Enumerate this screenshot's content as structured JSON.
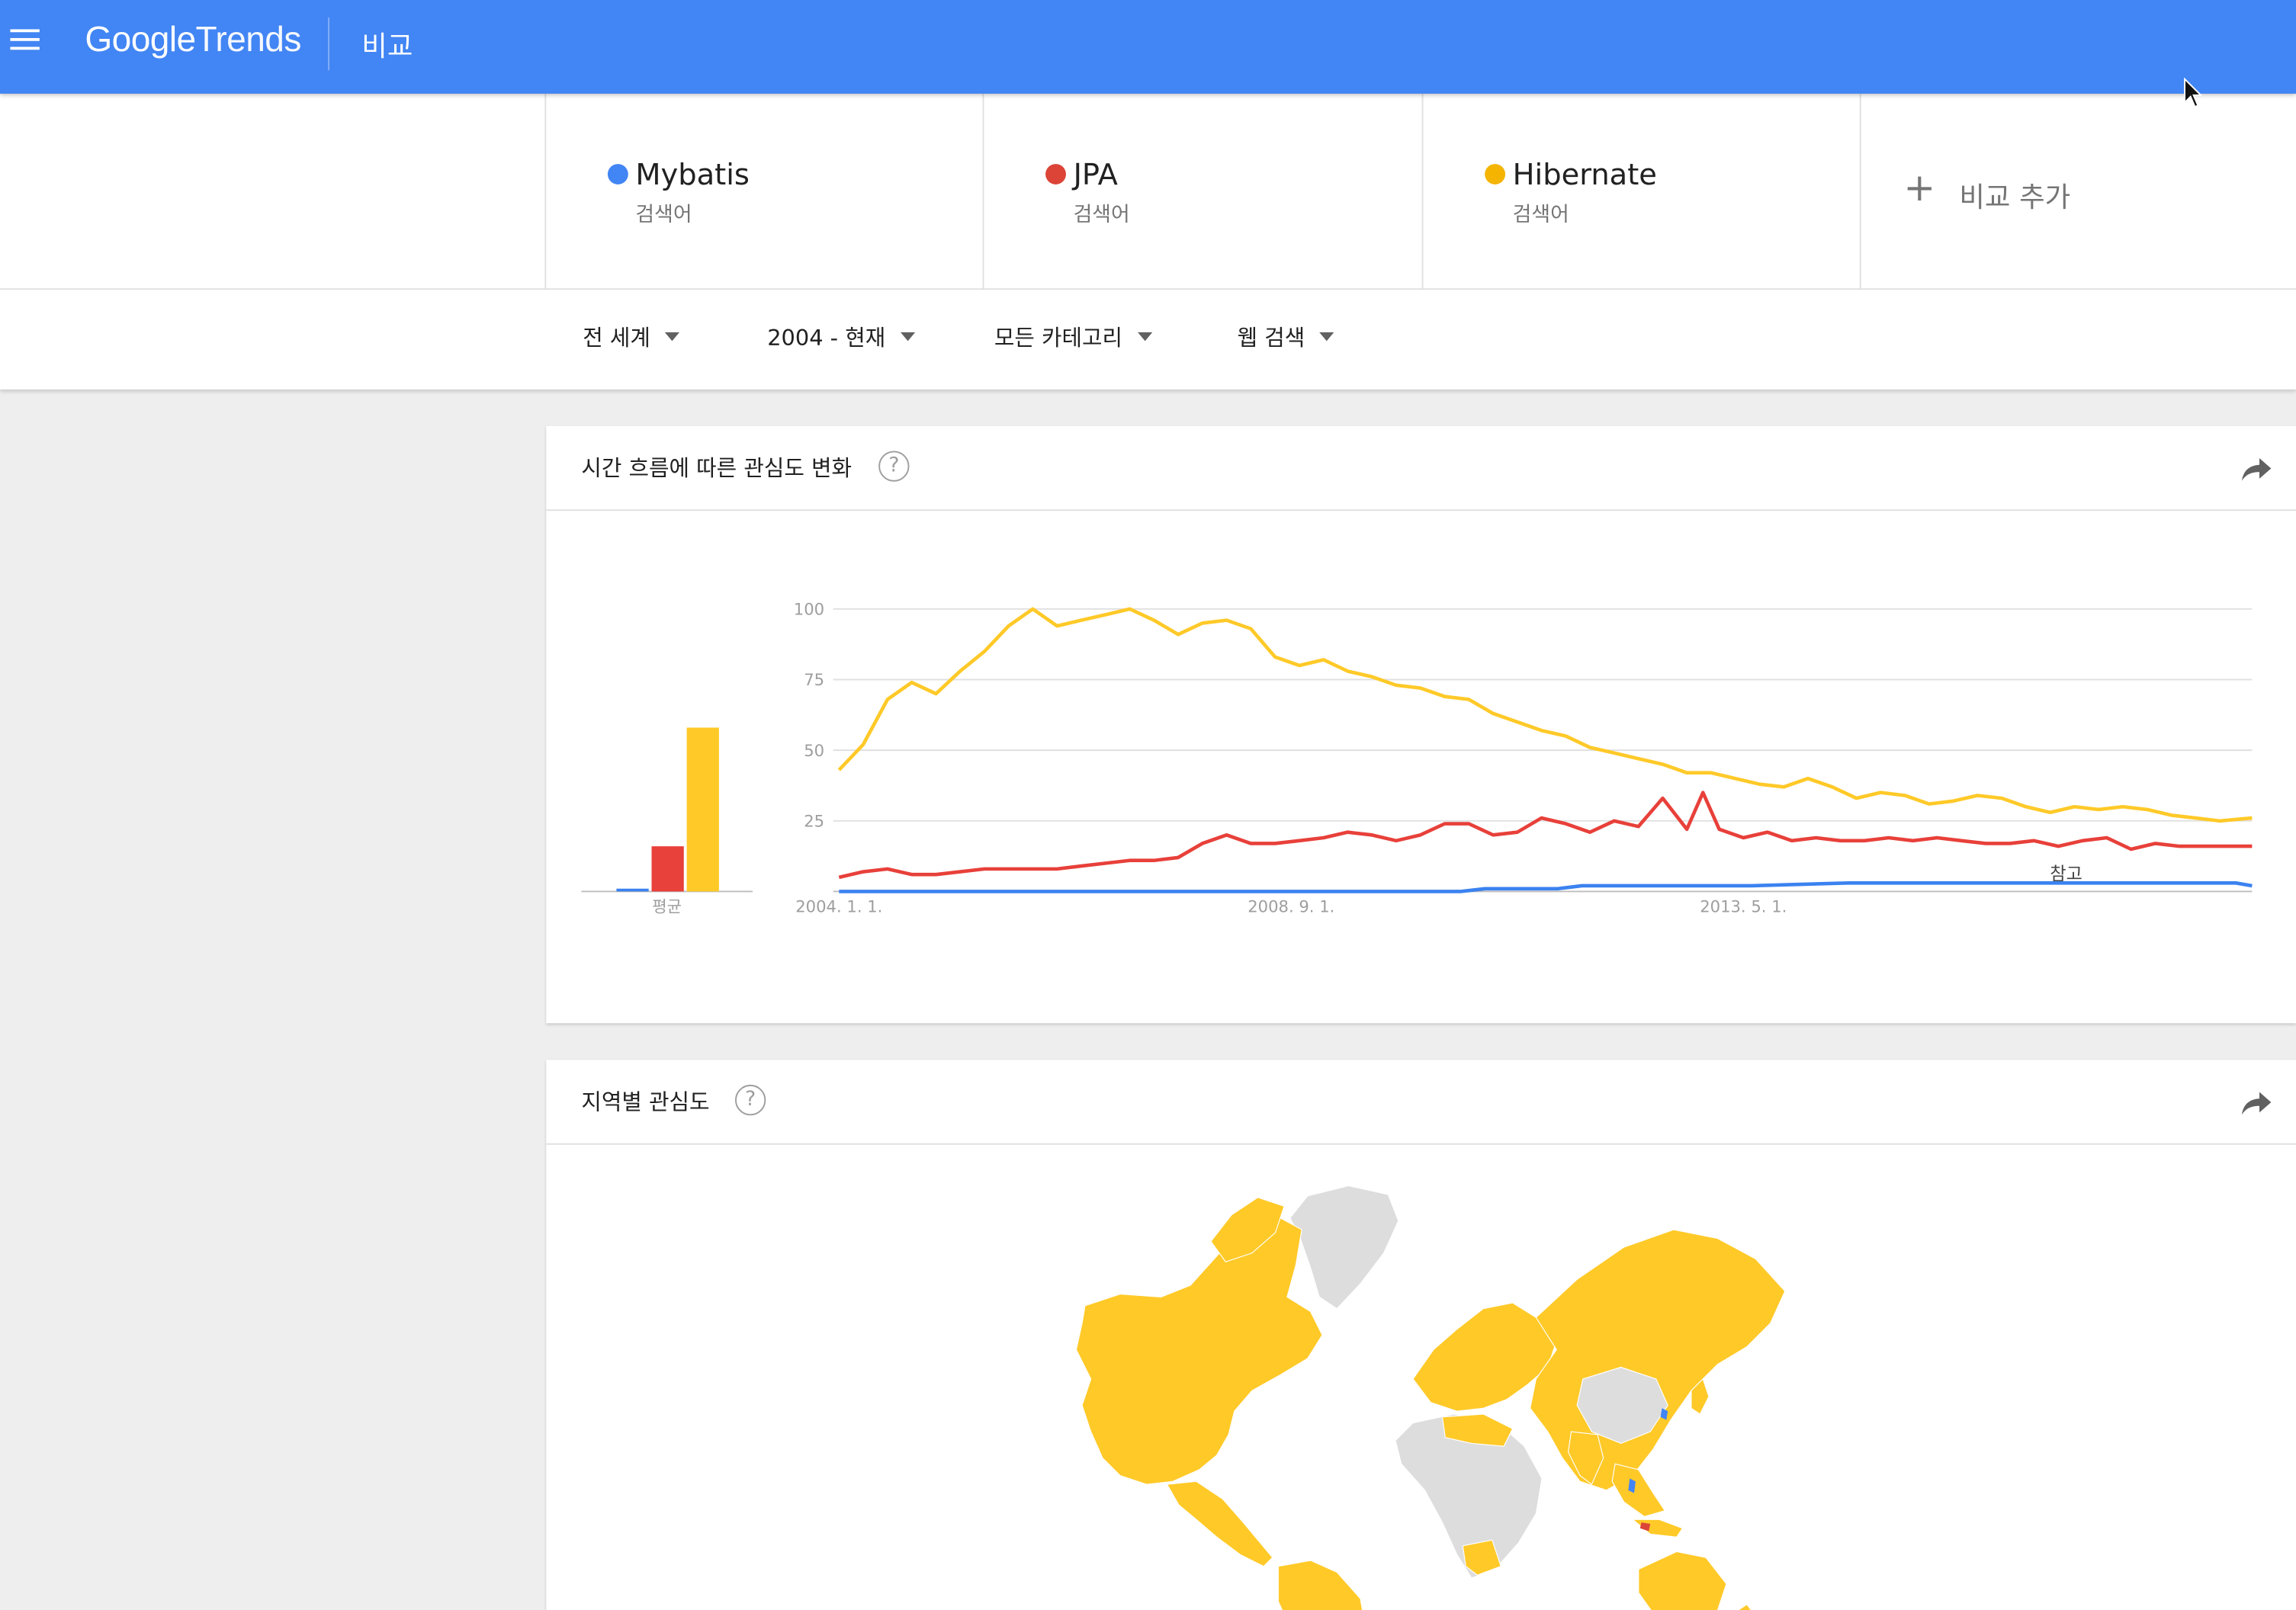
{
  "app": {
    "logo_google": "Google",
    "logo_trends": "Trends",
    "page_title": "비교"
  },
  "terms": [
    {
      "name": "Mybatis",
      "type": "검색어",
      "color": "#4285f4"
    },
    {
      "name": "JPA",
      "type": "검색어",
      "color": "#db4437"
    },
    {
      "name": "Hibernate",
      "type": "검색어",
      "color": "#f4b400"
    }
  ],
  "add_compare": {
    "icon": "plus-icon",
    "label": "비교 추가"
  },
  "filters": {
    "region": "전 세계",
    "period": "2004 - 현재",
    "category": "모든 카테고리",
    "search_type": "웹 검색"
  },
  "interest_over_time": {
    "title": "시간 흐름에 따른 관심도 변화",
    "help_symbol": "?",
    "average_label": "평균",
    "note_label": "참고"
  },
  "interest_by_region": {
    "title": "지역별 관심도",
    "help_symbol": "?"
  },
  "colors": {
    "header": "#4285f4",
    "mybatis": "#4285f4",
    "jpa": "#db4437",
    "hibernate": "#f4b400",
    "map_hibernate": "#ffc928",
    "map_nodata": "#dddddd"
  },
  "chart_data": {
    "type": "line",
    "x_tick_labels": [
      "2004. 1. 1.",
      "2008. 9. 1.",
      "2013. 5. 1."
    ],
    "x_start": "2004-01",
    "x_end": "2018-08",
    "ylim": [
      0,
      100
    ],
    "y_ticks": [
      100,
      75,
      50,
      25
    ],
    "grid": true,
    "averages": [
      {
        "name": "Mybatis",
        "value": 1
      },
      {
        "name": "JPA",
        "value": 16
      },
      {
        "name": "Hibernate",
        "value": 58
      }
    ],
    "series": [
      {
        "name": "Hibernate",
        "points": [
          [
            "2004-01",
            43
          ],
          [
            "2004-04",
            52
          ],
          [
            "2004-07",
            68
          ],
          [
            "2004-10",
            74
          ],
          [
            "2005-01",
            70
          ],
          [
            "2005-04",
            78
          ],
          [
            "2005-07",
            85
          ],
          [
            "2005-10",
            94
          ],
          [
            "2006-01",
            100
          ],
          [
            "2006-04",
            94
          ],
          [
            "2006-07",
            96
          ],
          [
            "2006-10",
            98
          ],
          [
            "2007-01",
            100
          ],
          [
            "2007-04",
            96
          ],
          [
            "2007-07",
            91
          ],
          [
            "2007-10",
            95
          ],
          [
            "2008-01",
            96
          ],
          [
            "2008-04",
            93
          ],
          [
            "2008-07",
            83
          ],
          [
            "2008-10",
            80
          ],
          [
            "2009-01",
            82
          ],
          [
            "2009-04",
            78
          ],
          [
            "2009-07",
            76
          ],
          [
            "2009-10",
            73
          ],
          [
            "2010-01",
            72
          ],
          [
            "2010-04",
            69
          ],
          [
            "2010-07",
            68
          ],
          [
            "2010-10",
            63
          ],
          [
            "2011-01",
            60
          ],
          [
            "2011-04",
            57
          ],
          [
            "2011-07",
            55
          ],
          [
            "2011-10",
            51
          ],
          [
            "2012-01",
            49
          ],
          [
            "2012-04",
            47
          ],
          [
            "2012-07",
            45
          ],
          [
            "2012-10",
            42
          ],
          [
            "2013-01",
            42
          ],
          [
            "2013-04",
            40
          ],
          [
            "2013-07",
            38
          ],
          [
            "2013-10",
            37
          ],
          [
            "2014-01",
            40
          ],
          [
            "2014-04",
            37
          ],
          [
            "2014-07",
            33
          ],
          [
            "2014-10",
            35
          ],
          [
            "2015-01",
            34
          ],
          [
            "2015-04",
            31
          ],
          [
            "2015-07",
            32
          ],
          [
            "2015-10",
            34
          ],
          [
            "2016-01",
            33
          ],
          [
            "2016-04",
            30
          ],
          [
            "2016-07",
            28
          ],
          [
            "2016-10",
            30
          ],
          [
            "2017-01",
            29
          ],
          [
            "2017-04",
            30
          ],
          [
            "2017-07",
            29
          ],
          [
            "2017-10",
            27
          ],
          [
            "2018-01",
            26
          ],
          [
            "2018-04",
            25
          ],
          [
            "2018-08",
            26
          ]
        ]
      },
      {
        "name": "JPA",
        "points": [
          [
            "2004-01",
            5
          ],
          [
            "2004-04",
            7
          ],
          [
            "2004-07",
            8
          ],
          [
            "2004-10",
            6
          ],
          [
            "2005-01",
            6
          ],
          [
            "2005-04",
            7
          ],
          [
            "2005-07",
            8
          ],
          [
            "2005-10",
            8
          ],
          [
            "2006-01",
            8
          ],
          [
            "2006-04",
            8
          ],
          [
            "2006-07",
            9
          ],
          [
            "2006-10",
            10
          ],
          [
            "2007-01",
            11
          ],
          [
            "2007-04",
            11
          ],
          [
            "2007-07",
            12
          ],
          [
            "2007-10",
            17
          ],
          [
            "2008-01",
            20
          ],
          [
            "2008-04",
            17
          ],
          [
            "2008-07",
            17
          ],
          [
            "2008-10",
            18
          ],
          [
            "2009-01",
            19
          ],
          [
            "2009-04",
            21
          ],
          [
            "2009-07",
            20
          ],
          [
            "2009-10",
            18
          ],
          [
            "2010-01",
            20
          ],
          [
            "2010-04",
            24
          ],
          [
            "2010-07",
            24
          ],
          [
            "2010-10",
            20
          ],
          [
            "2011-01",
            21
          ],
          [
            "2011-04",
            26
          ],
          [
            "2011-07",
            24
          ],
          [
            "2011-10",
            21
          ],
          [
            "2012-01",
            25
          ],
          [
            "2012-04",
            23
          ],
          [
            "2012-07",
            33
          ],
          [
            "2012-10",
            22
          ],
          [
            "2012-12",
            35
          ],
          [
            "2013-02",
            22
          ],
          [
            "2013-05",
            19
          ],
          [
            "2013-08",
            21
          ],
          [
            "2013-11",
            18
          ],
          [
            "2014-02",
            19
          ],
          [
            "2014-05",
            18
          ],
          [
            "2014-08",
            18
          ],
          [
            "2014-11",
            19
          ],
          [
            "2015-02",
            18
          ],
          [
            "2015-05",
            19
          ],
          [
            "2015-08",
            18
          ],
          [
            "2015-11",
            17
          ],
          [
            "2016-02",
            17
          ],
          [
            "2016-05",
            18
          ],
          [
            "2016-08",
            16
          ],
          [
            "2016-11",
            18
          ],
          [
            "2017-02",
            19
          ],
          [
            "2017-05",
            15
          ],
          [
            "2017-08",
            17
          ],
          [
            "2017-11",
            16
          ],
          [
            "2018-02",
            16
          ],
          [
            "2018-05",
            16
          ],
          [
            "2018-08",
            16
          ]
        ]
      },
      {
        "name": "Mybatis",
        "points": [
          [
            "2004-01",
            0
          ],
          [
            "2010-06",
            0
          ],
          [
            "2010-09",
            1
          ],
          [
            "2011-06",
            1
          ],
          [
            "2011-09",
            2
          ],
          [
            "2012-06",
            2
          ],
          [
            "2012-09",
            2
          ],
          [
            "2013-06",
            2
          ],
          [
            "2014-06",
            3
          ],
          [
            "2015-06",
            3
          ],
          [
            "2016-06",
            3
          ],
          [
            "2017-06",
            3
          ],
          [
            "2018-06",
            3
          ],
          [
            "2018-08",
            2
          ]
        ]
      }
    ]
  }
}
